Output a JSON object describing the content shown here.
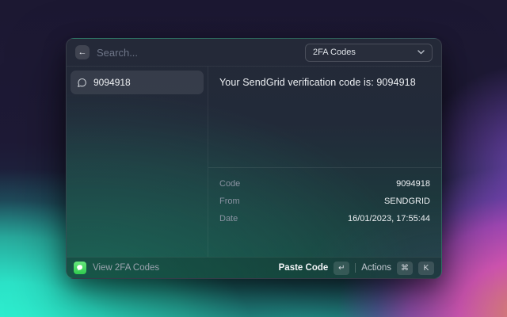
{
  "window": {
    "header": {
      "back_icon": "←",
      "search_placeholder": "Search...",
      "dropdown": {
        "value": "2FA Codes"
      }
    },
    "list": {
      "items": [
        {
          "icon": "speech-bubble",
          "label": "9094918"
        }
      ]
    },
    "detail": {
      "message": "Your SendGrid verification code is: 9094918",
      "rows": [
        {
          "label": "Code",
          "value": "9094918"
        },
        {
          "label": "From",
          "value": "SENDGRID"
        },
        {
          "label": "Date",
          "value": "16/01/2023, 17:55:44"
        }
      ]
    },
    "footer": {
      "app_label": "View 2FA Codes",
      "primary_action": "Paste Code",
      "primary_key": "↵",
      "secondary_action": "Actions",
      "secondary_keys": [
        "⌘",
        "K"
      ]
    }
  },
  "colors": {
    "accent_green": "#2fcb4e",
    "bg_turquoise": "#2ef5d2",
    "bg_magenta": "#e055b9",
    "bg_violet": "#8752d7",
    "bg_navy": "#1c1832"
  }
}
